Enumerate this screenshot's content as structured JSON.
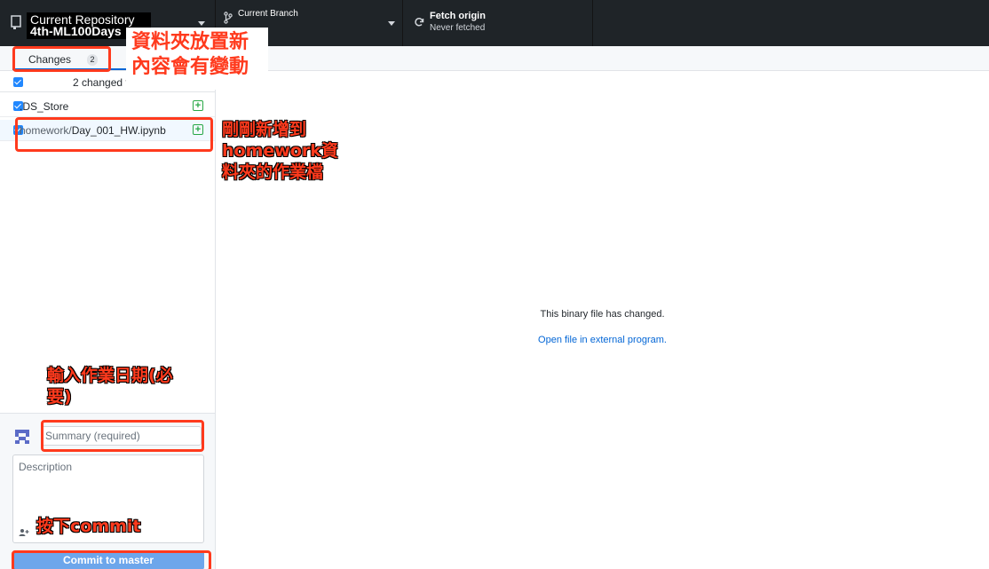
{
  "toolbar": {
    "repo": {
      "label": "Current Repository",
      "value": "4th-ML100Days"
    },
    "branch": {
      "label": "Current Branch"
    },
    "fetch": {
      "label": "Fetch origin",
      "sub": "Never fetched"
    }
  },
  "tabs": {
    "changes_label": "Changes",
    "changes_count": "2"
  },
  "sidebar": {
    "header_text": "2 changed files",
    "files": [
      {
        "dir": "",
        "name": ".DS_Store"
      },
      {
        "dir": "homework/",
        "name": "Day_001_HW.ipynb"
      }
    ]
  },
  "commit": {
    "summary_placeholder": "Summary (required)",
    "description_placeholder": "Description",
    "button_prefix": "Commit to ",
    "button_branch": "master"
  },
  "main": {
    "binary_message": "This binary file has changed.",
    "open_link": "Open file in external program."
  },
  "annotations": {
    "folder_note": "資料夾放置新內容會有變動",
    "file_note": "剛剛新增到homework資料夾的作業檔",
    "summary_note": "輸入作業日期(必要)",
    "commit_note": "按下commit"
  },
  "colors": {
    "accent": "#0366d6",
    "annotation": "#ff3a1d",
    "toolbar": "#1f2428",
    "commit_button": "#6da6eb"
  }
}
